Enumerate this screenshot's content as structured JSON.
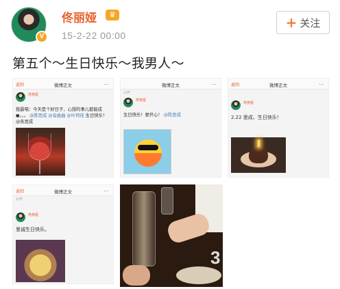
{
  "header": {
    "username": "佟丽娅",
    "time": "15-2-22 00:00",
    "follow_label": "关注",
    "verified_badge": "V"
  },
  "post": {
    "text": "第五个～生日快乐～我男人～"
  },
  "tiles": [
    {
      "back": "返回",
      "title": "微博正文",
      "more": "…",
      "name": "佟丽娅",
      "text": "我最喵：今天是个好日子，心想的事儿都能成●。。。",
      "mentions": "@陈思成 @音曲曲 @叶珂佳",
      "text2": "生日快乐！ @各思成"
    },
    {
      "back": "",
      "title": "微博正文",
      "more": "…",
      "sub": "公开",
      "name": "佟丽娅",
      "text": "生日快乐！要开心！",
      "mentions": "@陈思成"
    },
    {
      "back": "返回",
      "title": "微博正文",
      "more": "…",
      "name": "佟丽娅",
      "text": "2.22 思成，生日快乐！"
    },
    {
      "back": "返回",
      "title": "微博正文",
      "more": "…",
      "sub": "公开",
      "name": "佟丽娅",
      "text": "思诚生日快乐。"
    }
  ],
  "big_photo": {
    "number": "3"
  },
  "colors": {
    "brand_orange": "#e8622c",
    "link_blue": "#4a7ab5",
    "badge_gold": "#f5a623"
  }
}
